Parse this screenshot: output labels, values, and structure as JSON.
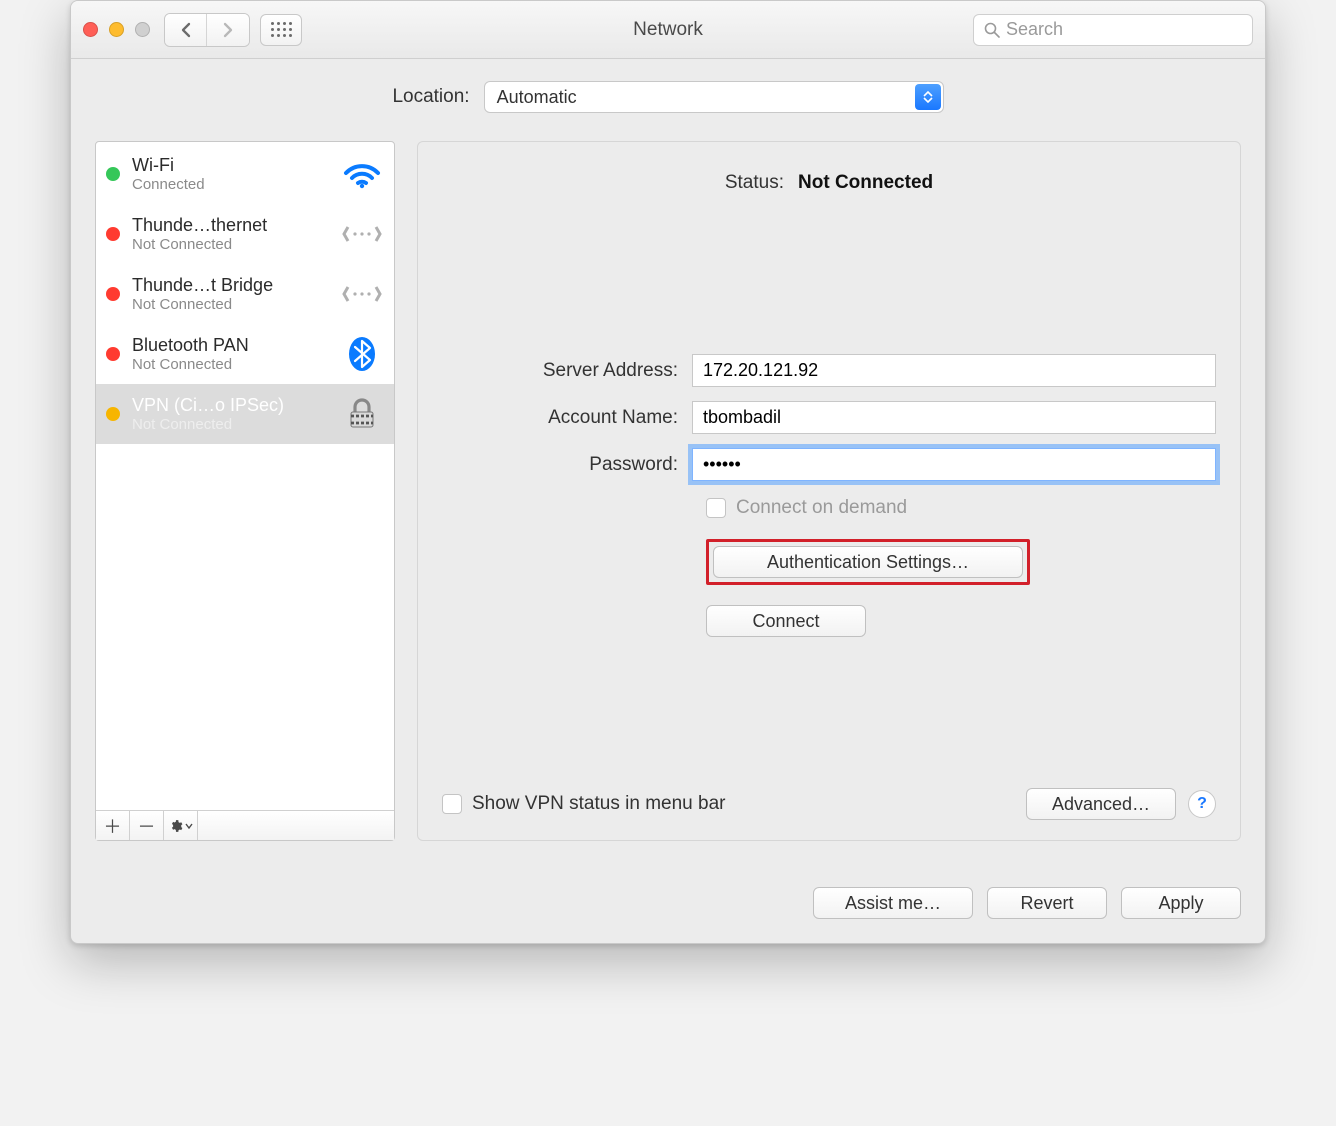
{
  "window": {
    "title": "Network"
  },
  "toolbar": {
    "search_placeholder": "Search"
  },
  "location": {
    "label": "Location:",
    "value": "Automatic"
  },
  "sidebar": {
    "items": [
      {
        "name": "Wi-Fi",
        "status": "Connected",
        "bullet": "green",
        "icon": "wifi"
      },
      {
        "name": "Thunde…thernet",
        "status": "Not Connected",
        "bullet": "red",
        "icon": "ethernet"
      },
      {
        "name": "Thunde…t Bridge",
        "status": "Not Connected",
        "bullet": "red",
        "icon": "ethernet"
      },
      {
        "name": "Bluetooth PAN",
        "status": "Not Connected",
        "bullet": "red",
        "icon": "bluetooth"
      },
      {
        "name": "VPN (Ci…o IPSec)",
        "status": "Not Connected",
        "bullet": "orange",
        "icon": "vpn-lock",
        "selected": true
      }
    ]
  },
  "detail": {
    "status_label": "Status:",
    "status_value": "Not Connected",
    "server_label": "Server Address:",
    "server_value": "172.20.121.92",
    "account_label": "Account Name:",
    "account_value": "tbombadil",
    "password_label": "Password:",
    "password_value": "••••••",
    "connect_on_demand": "Connect on demand",
    "auth_button": "Authentication Settings…",
    "connect_button": "Connect",
    "show_vpn": "Show VPN status in menu bar",
    "advanced": "Advanced…"
  },
  "footer": {
    "assist": "Assist me…",
    "revert": "Revert",
    "apply": "Apply"
  }
}
